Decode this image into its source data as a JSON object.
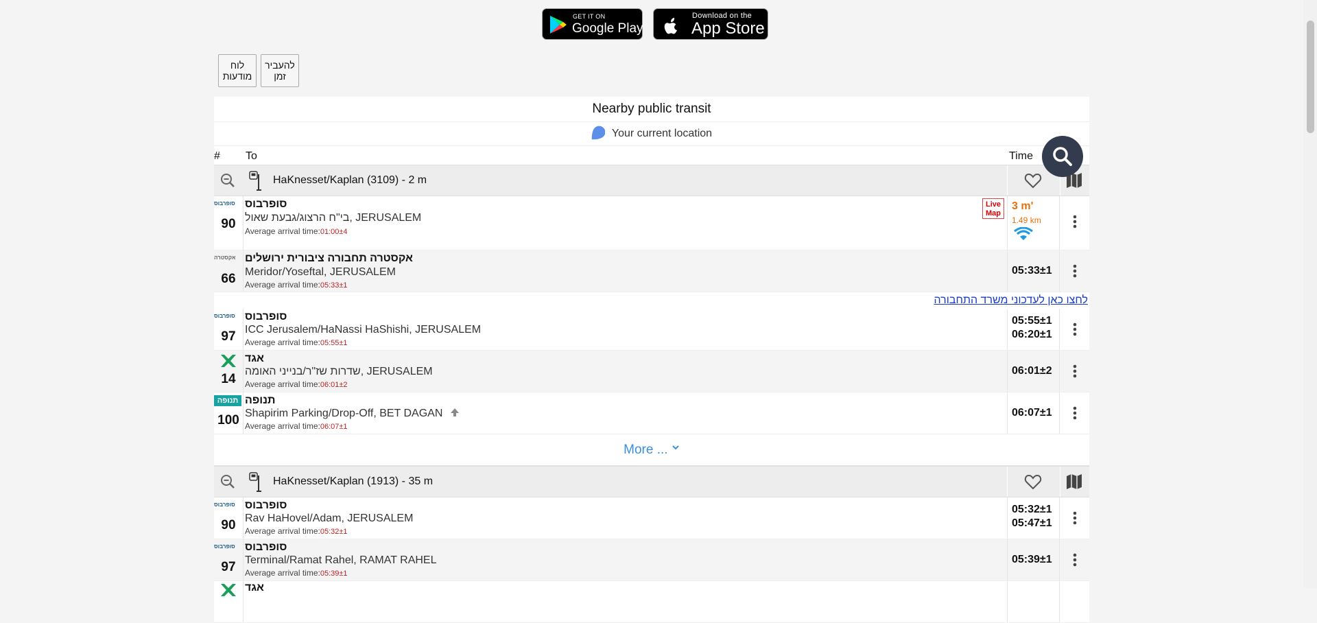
{
  "store": {
    "google_small": "GET IT ON",
    "google_big": "Google Play",
    "apple_small": "Download on the",
    "apple_big": "App Store"
  },
  "buttons": {
    "board": "לוח מודעות",
    "change_time": "להעביר זמן"
  },
  "page": {
    "title": "Nearby public transit",
    "location": "Your current location",
    "col_num": "#",
    "col_to": "To",
    "col_time": "Time"
  },
  "stop1": {
    "name": "HaKnesset/Kaplan (3109) - 2 m",
    "rows": [
      {
        "logo": "סופרבוס",
        "line": "90",
        "operator": "סופרבוס",
        "dest": "בי\"ח הרצוג/גבעת שאול, JERUSALEM",
        "avg_label": "Average arrival time:",
        "avg": "01:00±4",
        "live": "Live Map",
        "eta": "3 m'",
        "eta_dist": "1.49 km"
      },
      {
        "logo": "אקסטרה",
        "line": "66",
        "operator": "אקסטרה תחבורה ציבורית ירושלים",
        "dest": "Meridor/Yoseftal, JERUSALEM",
        "avg_label": "Average arrival time:",
        "avg": "05:33±1",
        "time1": "05:33±1"
      },
      {
        "logo": "סופרבוס",
        "line": "97",
        "operator": "סופרבוס",
        "dest": "ICC Jerusalem/HaNassi HaShishi, JERUSALEM",
        "avg_label": "Average arrival time:",
        "avg": "05:55±1",
        "time1": "05:55±1",
        "time2": "06:20±1"
      },
      {
        "logo": "אגד",
        "line": "14",
        "operator": "אגד",
        "dest": "שדרות שז\"ר/בנייני האומה, JERUSALEM",
        "avg_label": "Average arrival time:",
        "avg": "06:01±2",
        "time1": "06:01±2"
      },
      {
        "logo": "תנופה",
        "line": "100",
        "operator": "תנופה",
        "dest": "Shapirim Parking/Drop-Off, BET DAGAN",
        "avg_label": "Average arrival time:",
        "avg": "06:07±1",
        "time1": "06:07±1"
      }
    ],
    "report_link": "לחצו כאן לעדכוני משרד התחבורה",
    "more": "More ..."
  },
  "stop2": {
    "name": "HaKnesset/Kaplan (1913) - 35 m",
    "rows": [
      {
        "logo": "סופרבוס",
        "line": "90",
        "operator": "סופרבוס",
        "dest": "Rav HaHovel/Adam, JERUSALEM",
        "avg_label": "Average arrival time:",
        "avg": "05:32±1",
        "time1": "05:32±1",
        "time2": "05:47±1"
      },
      {
        "logo": "סופרבוס",
        "line": "97",
        "operator": "סופרבוס",
        "dest": "Terminal/Ramat Rahel, RAMAT RAHEL",
        "avg_label": "Average arrival time:",
        "avg": "05:39±1",
        "time1": "05:39±1"
      },
      {
        "operator": "אגד"
      }
    ]
  },
  "colors": {
    "eta": "#e8700a",
    "fab": "#323c4e",
    "link": "#1a3cc8",
    "more": "#3a8fdc"
  }
}
